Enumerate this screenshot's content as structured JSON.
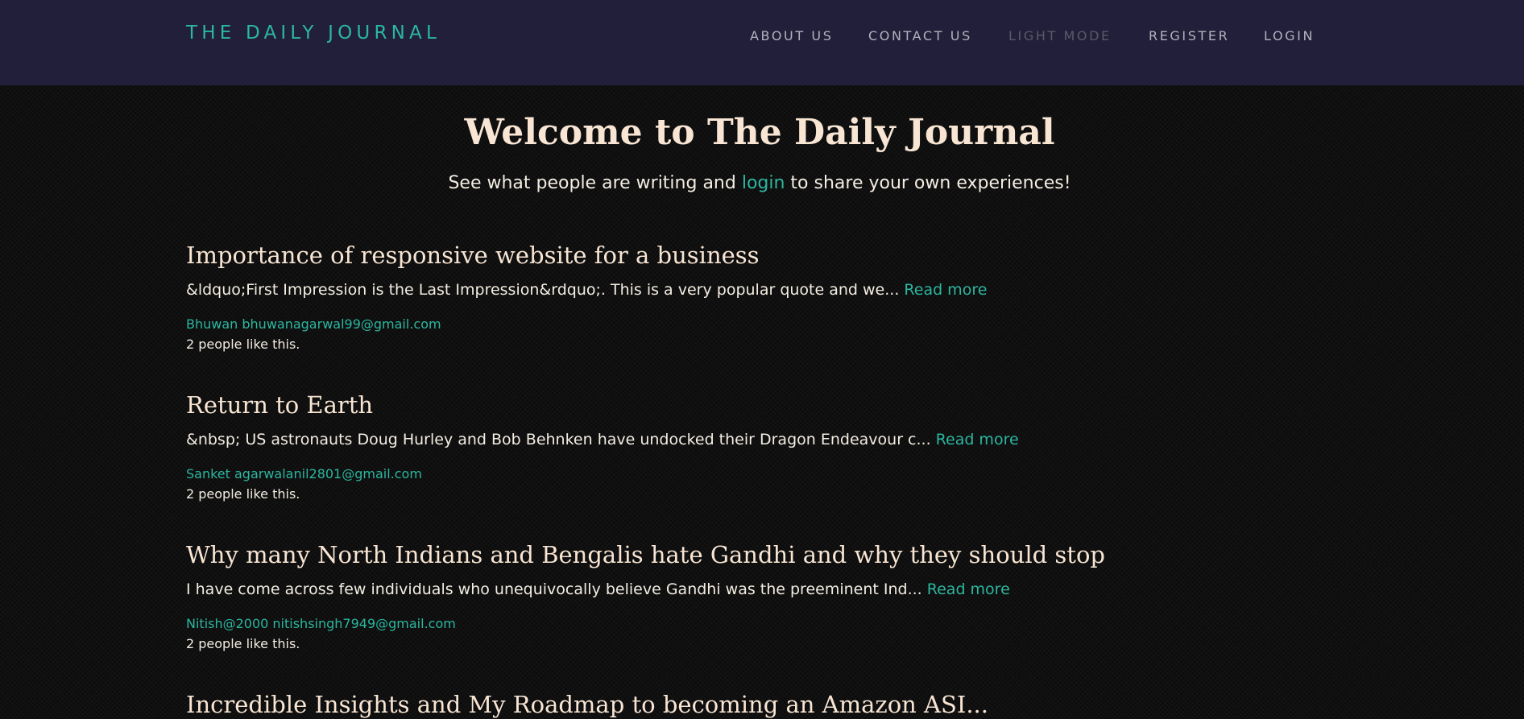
{
  "brand": "THE DAILY JOURNAL",
  "nav": {
    "about": "ABOUT US",
    "contact": "CONTACT US",
    "light_mode": "LIGHT MODE",
    "register": "REGISTER",
    "login": "LOGIN"
  },
  "hero": {
    "title": "Welcome to The Daily Journal",
    "sub_before": "See what people are writing and ",
    "sub_link": "login",
    "sub_after": " to share your own experiences!"
  },
  "posts": [
    {
      "title": "Importance of responsive website for a business",
      "excerpt": "&ldquo;First Impression is the Last Impression&rdquo;. This is a very popular quote and we...",
      "read_more": "Read more",
      "author": "Bhuwan bhuwanagarwal99@gmail.com",
      "likes": "2 people like this."
    },
    {
      "title": "Return to Earth",
      "excerpt": "&nbsp; US astronauts Doug Hurley and Bob Behnken have undocked their Dragon Endeavour c...",
      "read_more": "Read more",
      "author": "Sanket agarwalanil2801@gmail.com",
      "likes": "2 people like this."
    },
    {
      "title": "Why many North Indians and Bengalis hate Gandhi and why they should stop",
      "excerpt": "I have come across few individuals who unequivocally believe Gandhi was the preeminent Ind...",
      "read_more": "Read more",
      "author": "Nitish@2000 nitishsingh7949@gmail.com",
      "likes": "2 people like this."
    },
    {
      "title": "Incredible Insights and My Roadmap to becoming an Amazon ASI..."
    }
  ],
  "colors": {
    "navbar": "#221f3a",
    "accent": "#2bb7a0",
    "heading": "#f8e5d3",
    "background": "#0b0b0b"
  }
}
